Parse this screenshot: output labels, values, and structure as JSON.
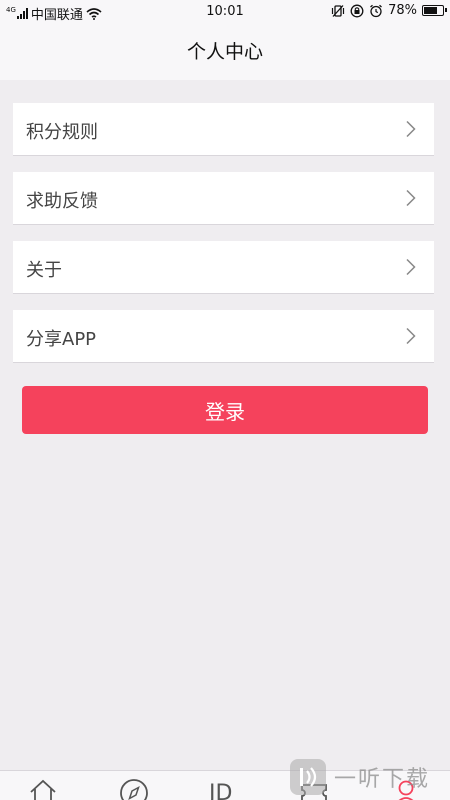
{
  "status_bar": {
    "network_type": "4G",
    "carrier": "中国联通",
    "time": "10:01",
    "battery": "78%",
    "battery_level": 0.78
  },
  "header": {
    "title": "个人中心"
  },
  "menu": {
    "items": [
      {
        "label": "积分规则"
      },
      {
        "label": "求助反馈"
      },
      {
        "label": "关于"
      },
      {
        "label": "分享APP"
      }
    ]
  },
  "login_button": {
    "label": "登录"
  },
  "tab_bar": {
    "tabs": [
      {
        "icon": "home-icon"
      },
      {
        "icon": "compass-icon"
      },
      {
        "icon": "jd-icon",
        "text": "JD"
      },
      {
        "icon": "ticket-icon"
      },
      {
        "icon": "user-icon",
        "active": true
      }
    ],
    "active_color": "#f5425c"
  },
  "watermark": {
    "text": "一听下载"
  },
  "colors": {
    "accent": "#f5425c",
    "background": "#efedf0",
    "card": "#ffffff"
  }
}
